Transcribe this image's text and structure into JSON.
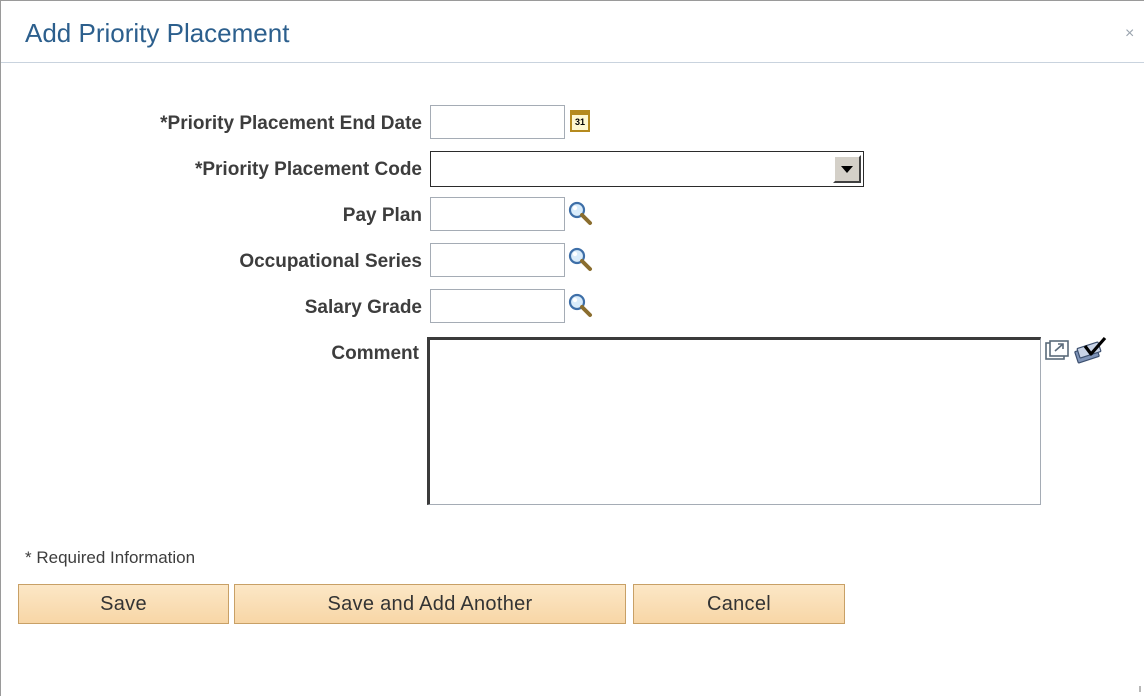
{
  "dialog": {
    "title": "Add Priority Placement",
    "close_glyph": "×"
  },
  "form": {
    "end_date_label": "*Priority Placement End Date",
    "end_date_value": "",
    "code_label": "*Priority Placement Code",
    "code_value": "",
    "pay_plan_label": "Pay Plan",
    "pay_plan_value": "",
    "occupational_series_label": "Occupational Series",
    "occupational_series_value": "",
    "salary_grade_label": "Salary Grade",
    "salary_grade_value": "",
    "comment_label": "Comment",
    "comment_value": ""
  },
  "calendar": {
    "day_text": "31"
  },
  "footer": {
    "required_note": "* Required Information"
  },
  "buttons": {
    "save": "Save",
    "save_add_another": "Save and Add Another",
    "cancel": "Cancel"
  },
  "icons": {
    "calendar": "calendar-icon",
    "lookup": "magnifier-icon",
    "expand": "expand-icon",
    "spellcheck": "spellcheck-icon",
    "close": "close-icon"
  },
  "colors": {
    "title": "#2c5f8d",
    "button_bg": "#f7d6a6",
    "button_border": "#c8a066",
    "label": "#3d3d3d"
  }
}
